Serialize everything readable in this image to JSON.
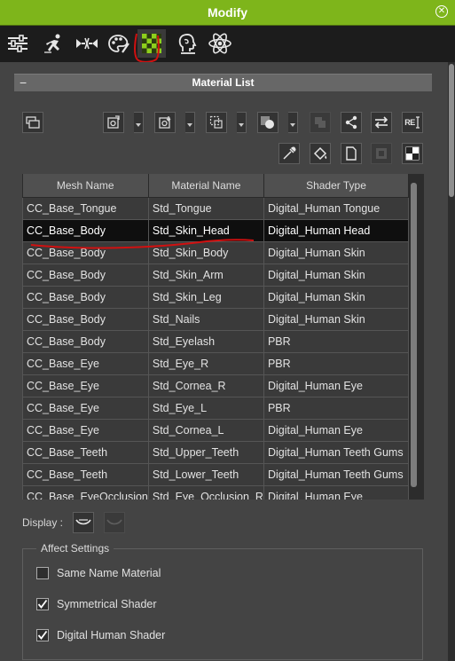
{
  "window": {
    "title": "Modify",
    "close_icon": "close-circle-icon"
  },
  "toolbar": {
    "icons": [
      "sliders-icon",
      "motion-pose-icon",
      "morph-arrows-icon",
      "palette-icon",
      "material-checker-icon",
      "head-profile-icon",
      "atom-icon"
    ],
    "active": "material-checker-icon"
  },
  "section": {
    "title": "Material List",
    "collapse_symbol": "−"
  },
  "toolbar_buttons": {
    "re_button_text": "RE"
  },
  "table": {
    "columns": [
      "Mesh Name",
      "Material Name",
      "Shader Type"
    ],
    "rows": [
      [
        "CC_Base_Tongue",
        "Std_Tongue",
        "Digital_Human Tongue"
      ],
      [
        "CC_Base_Body",
        "Std_Skin_Head",
        "Digital_Human Head"
      ],
      [
        "CC_Base_Body",
        "Std_Skin_Body",
        "Digital_Human Skin"
      ],
      [
        "CC_Base_Body",
        "Std_Skin_Arm",
        "Digital_Human Skin"
      ],
      [
        "CC_Base_Body",
        "Std_Skin_Leg",
        "Digital_Human Skin"
      ],
      [
        "CC_Base_Body",
        "Std_Nails",
        "Digital_Human Skin"
      ],
      [
        "CC_Base_Body",
        "Std_Eyelash",
        "PBR"
      ],
      [
        "CC_Base_Eye",
        "Std_Eye_R",
        "PBR"
      ],
      [
        "CC_Base_Eye",
        "Std_Cornea_R",
        "Digital_Human Eye"
      ],
      [
        "CC_Base_Eye",
        "Std_Eye_L",
        "PBR"
      ],
      [
        "CC_Base_Eye",
        "Std_Cornea_L",
        "Digital_Human Eye"
      ],
      [
        "CC_Base_Teeth",
        "Std_Upper_Teeth",
        "Digital_Human Teeth Gums"
      ],
      [
        "CC_Base_Teeth",
        "Std_Lower_Teeth",
        "Digital_Human Teeth Gums"
      ],
      [
        "CC_Base_EyeOcclusion",
        "Std_Eye_Occlusion_R",
        "Digital_Human Eye"
      ]
    ],
    "selected_index": 1
  },
  "display": {
    "label": "Display :"
  },
  "affect": {
    "title": "Affect Settings",
    "options": [
      {
        "label": "Same Name Material",
        "checked": false
      },
      {
        "label": "Symmetrical Shader",
        "checked": true
      },
      {
        "label": "Digital Human Shader",
        "checked": true
      }
    ]
  },
  "colors": {
    "accent": "#7eb51b",
    "panel": "#444444",
    "selected_row": "#0f0f0f",
    "annotation": "#d01010"
  }
}
